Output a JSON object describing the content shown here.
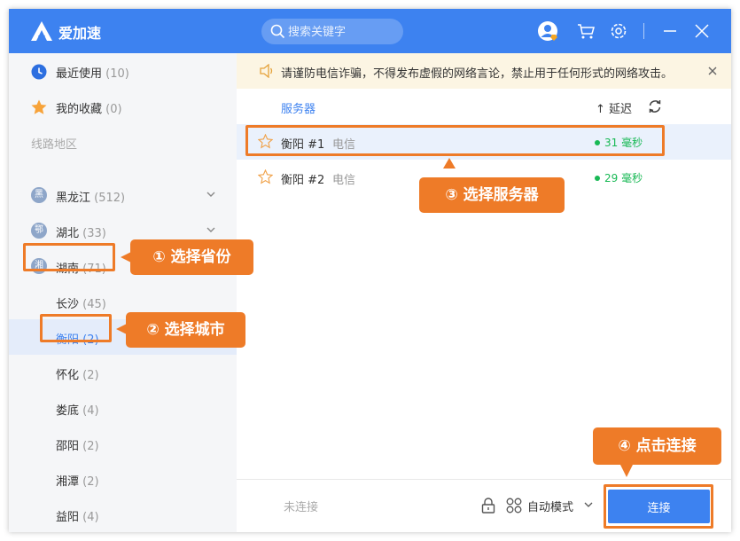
{
  "app": {
    "title": "爱加速"
  },
  "search": {
    "placeholder": "搜索关键字"
  },
  "sidebar": {
    "recent": {
      "label": "最近使用",
      "count": "(10)"
    },
    "favorites": {
      "label": "我的收藏",
      "count": "(0)"
    },
    "section_title": "线路地区",
    "provinces": [
      {
        "badge": "黑",
        "label": "黑龙江",
        "count": "(512)"
      },
      {
        "badge": "鄂",
        "label": "湖北",
        "count": "(33)"
      },
      {
        "badge": "湘",
        "label": "湖南",
        "count": "(71)"
      }
    ],
    "cities": [
      {
        "label": "长沙",
        "count": "(45)"
      },
      {
        "label": "衡阳",
        "count": "(2)"
      },
      {
        "label": "怀化",
        "count": "(2)"
      },
      {
        "label": "娄底",
        "count": "(4)"
      },
      {
        "label": "邵阳",
        "count": "(2)"
      },
      {
        "label": "湘潭",
        "count": "(2)"
      },
      {
        "label": "益阳",
        "count": "(4)"
      }
    ]
  },
  "notice": {
    "text": "请谨防电信诈骗，不得发布虚假的网络言论，禁止用于任何形式的网络攻击。"
  },
  "list": {
    "server_header": "服务器",
    "latency_header": "↑ 延迟",
    "servers": [
      {
        "name": "衡阳 #1",
        "isp": "电信",
        "ping": "31 毫秒"
      },
      {
        "name": "衡阳 #2",
        "isp": "电信",
        "ping": "29 毫秒"
      }
    ]
  },
  "footer": {
    "status": "未连接",
    "mode": "自动模式",
    "connect_label": "连接"
  },
  "annotations": {
    "step1": "① 选择省份",
    "step2": "② 选择城市",
    "step3": "③ 选择服务器",
    "step4": "④ 点击连接"
  },
  "colors": {
    "brand_blue": "#3d82f0",
    "highlight_orange": "#ee7b28",
    "ping_green": "#19b955",
    "notice_bg": "#fcf5e3"
  }
}
